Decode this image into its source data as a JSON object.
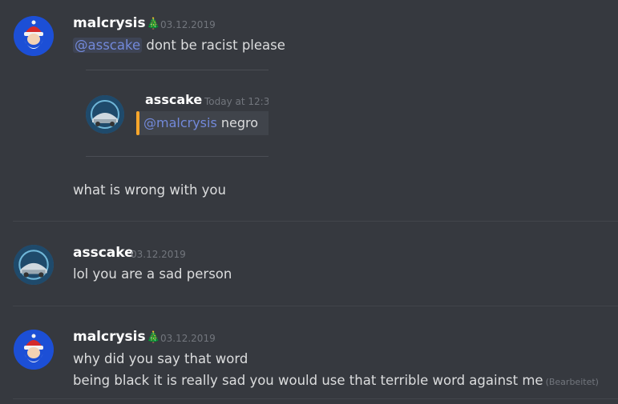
{
  "messages": [
    {
      "author": "malcrysis",
      "badge_emoji": "🎄",
      "timestamp": "03.12.2019",
      "avatar": "santa-avatar",
      "line1_mention": "@asscake",
      "line1_text": " dont be racist please",
      "embed": {
        "author": "asscake",
        "timestamp": "Today at 12:3",
        "mention": "@malcrysis",
        "text": " negro",
        "accent": "#f9a62b"
      },
      "line2": "what is wrong with you"
    },
    {
      "author": "asscake",
      "timestamp": "03.12.2019",
      "avatar": "car-avatar",
      "line1": "lol you are a sad person"
    },
    {
      "author": "malcrysis",
      "badge_emoji": "🎄",
      "timestamp": "03.12.2019",
      "avatar": "santa-avatar",
      "line1": "why did you say that word",
      "line2": "being black it is really sad you would use that terrible word against me",
      "edited_label": "(Bearbeitet)"
    }
  ],
  "colors": {
    "background": "#36393f",
    "mention": "#7289da",
    "username": "#ffffff",
    "timestamp": "#72767d"
  }
}
